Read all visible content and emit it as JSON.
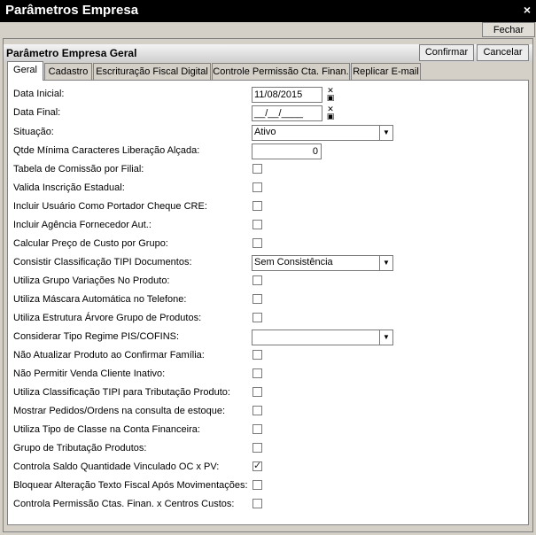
{
  "window": {
    "title": "Parâmetros Empresa",
    "close_icon": "×"
  },
  "toolbar": {
    "close_label": "Fechar"
  },
  "panel": {
    "title": "Parâmetro Empresa Geral",
    "confirm_label": "Confirmar",
    "cancel_label": "Cancelar"
  },
  "tabs": [
    {
      "label": "Geral"
    },
    {
      "label": "Cadastro"
    },
    {
      "label": "Escrituração Fiscal Digital"
    },
    {
      "label": "Controle Permissão Cta. Finan."
    },
    {
      "label": "Replicar E-mail"
    }
  ],
  "form": {
    "data_inicial": {
      "label": "Data Inicial:",
      "value": "11/08/2015"
    },
    "data_final": {
      "label": "Data Final:",
      "value": "__/__/____"
    },
    "situacao": {
      "label": "Situação:",
      "value": "Ativo"
    },
    "qtde": {
      "label": "Qtde Mínima Caracteres Liberação Alçada:",
      "value": "0"
    },
    "tabela_comissao": {
      "label": "Tabela de Comissão por Filial:",
      "checked": false
    },
    "valida_ie": {
      "label": "Valida Inscrição Estadual:",
      "checked": false
    },
    "incluir_usuario": {
      "label": "Incluir Usuário Como Portador Cheque CRE:",
      "checked": false
    },
    "incluir_agencia": {
      "label": "Incluir Agência Fornecedor Aut.:",
      "checked": false
    },
    "calcular_preco": {
      "label": "Calcular Preço de Custo por Grupo:",
      "checked": false
    },
    "consistir_tipi": {
      "label": "Consistir Classificação TIPI Documentos:",
      "value": "Sem Consistência"
    },
    "grupo_variacoes": {
      "label": "Utiliza Grupo Variações No Produto:",
      "checked": false
    },
    "mascara_telefone": {
      "label": "Utiliza Máscara Automática no Telefone:",
      "checked": false
    },
    "estrutura_arvore": {
      "label": "Utiliza Estrutura Árvore Grupo de Produtos:",
      "checked": false
    },
    "regime_pis": {
      "label": "Considerar Tipo Regime PIS/COFINS:",
      "value": ""
    },
    "nao_atualizar": {
      "label": "Não Atualizar Produto ao Confirmar Família:",
      "checked": false
    },
    "nao_permitir": {
      "label": "Não Permitir Venda Cliente Inativo:",
      "checked": false
    },
    "classif_tipi": {
      "label": "Utiliza Classificação TIPI para Tributação Produto:",
      "checked": false
    },
    "mostrar_pedidos": {
      "label": "Mostrar Pedidos/Ordens na consulta de estoque:",
      "checked": false
    },
    "tipo_classe": {
      "label": "Utiliza Tipo de Classe na Conta Financeira:",
      "checked": false
    },
    "grupo_tributacao": {
      "label": "Grupo de Tributação Produtos:",
      "checked": false
    },
    "controla_saldo": {
      "label": "Controla Saldo Quantidade Vinculado OC x PV:",
      "checked": true
    },
    "bloquear_alteracao": {
      "label": "Bloquear Alteração Texto Fiscal Após Movimentações:",
      "checked": false
    },
    "controla_permissao": {
      "label": "Controla Permissão Ctas. Finan. x Centros Custos:",
      "checked": false
    }
  }
}
